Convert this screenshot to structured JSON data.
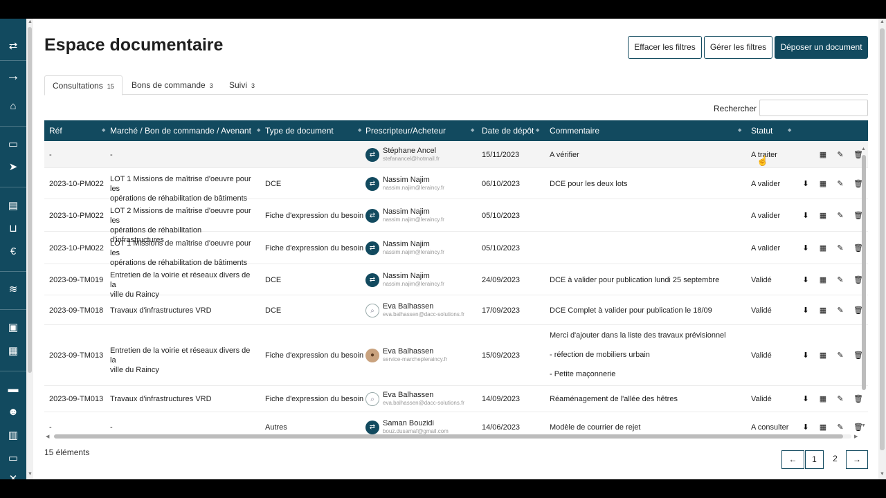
{
  "page": {
    "title": "Espace documentaire",
    "buttons": {
      "clear_filters": "Effacer les filtres",
      "manage_filters": "Gérer les filtres",
      "upload": "Déposer un document"
    }
  },
  "tabs": [
    {
      "label": "Consultations",
      "count": "15"
    },
    {
      "label": "Bons de commande",
      "count": "3"
    },
    {
      "label": "Suivi",
      "count": "3"
    }
  ],
  "search": {
    "label": "Rechercher :",
    "value": ""
  },
  "table": {
    "headers": [
      "Réf",
      "Marché / Bon de commande / Avenant",
      "Type de document",
      "Prescripteur/Acheteur",
      "Date de dépôt",
      "Commentaire",
      "Statut"
    ],
    "rows": [
      {
        "ref": "-",
        "marche": [
          "-"
        ],
        "type": "",
        "person": "Stéphane Ancel",
        "email": "stefanancel@hotmail.fr",
        "avatar": "logo",
        "date": "15/11/2023",
        "comment": [
          "A vérifier"
        ],
        "status": "A traiter",
        "actions": [
          "calendar",
          "edit",
          "delete"
        ]
      },
      {
        "ref": "2023-10-PM022",
        "marche": [
          "LOT 1 Missions de maîtrise d'oeuvre pour les",
          "opérations de réhabilitation de bâtiments"
        ],
        "type": "DCE",
        "person": "Nassim Najim",
        "email": "nassim.najim@leraincy.fr",
        "avatar": "logo",
        "date": "06/10/2023",
        "comment": [
          "DCE pour les deux lots"
        ],
        "status": "A valider",
        "actions": [
          "download",
          "calendar",
          "edit",
          "delete"
        ]
      },
      {
        "ref": "2023-10-PM022",
        "marche": [
          "LOT 2 Missions de maîtrise d'oeuvre pour les",
          "opérations de réhabilitation d'infrastructures"
        ],
        "type": "Fiche d'expression du besoin",
        "person": "Nassim Najim",
        "email": "nassim.najim@leraincy.fr",
        "avatar": "logo",
        "date": "05/10/2023",
        "comment": [
          ""
        ],
        "status": "A valider",
        "actions": [
          "download",
          "calendar",
          "edit",
          "delete"
        ]
      },
      {
        "ref": "2023-10-PM022",
        "marche": [
          "LOT 1 Missions de maîtrise d'oeuvre pour les",
          "opérations de réhabilitation de bâtiments"
        ],
        "type": "Fiche d'expression du besoin",
        "person": "Nassim Najim",
        "email": "nassim.najim@leraincy.fr",
        "avatar": "logo",
        "date": "05/10/2023",
        "comment": [
          ""
        ],
        "status": "A valider",
        "actions": [
          "download",
          "calendar",
          "edit",
          "delete"
        ]
      },
      {
        "ref": "2023-09-TM019",
        "marche": [
          "Entretien de la voirie et réseaux divers de la",
          "ville du Raincy"
        ],
        "type": "DCE",
        "person": "Nassim Najim",
        "email": "nassim.najim@leraincy.fr",
        "avatar": "logo",
        "date": "24/09/2023",
        "comment": [
          "DCE à valider pour publication lundi 25 septembre"
        ],
        "status": "Validé",
        "actions": [
          "download",
          "calendar",
          "edit",
          "delete"
        ]
      },
      {
        "ref": "2023-09-TM018",
        "marche": [
          "Travaux d'infrastructures VRD"
        ],
        "type": "DCE",
        "person": "Eva Balhassen",
        "email": "eva.balhassen@dacc-solutions.fr",
        "avatar": "outline",
        "date": "17/09/2023",
        "comment": [
          "DCE Complet à valider pour publication le 18/09"
        ],
        "status": "Validé",
        "actions": [
          "download",
          "calendar",
          "edit",
          "delete"
        ]
      },
      {
        "ref": "2023-09-TM013",
        "marche": [
          "Entretien de la voirie et réseaux divers de la",
          "ville du Raincy"
        ],
        "type": "Fiche d'expression du besoin",
        "person": "Eva Balhassen",
        "email": "service-marchepleraincy.fr",
        "avatar": "photo",
        "date": "15/09/2023",
        "comment": [
          "Merci d'ajouter dans la liste des travaux prévisionnel",
          "- réfection de mobiliers urbain",
          "- Petite maçonnerie"
        ],
        "status": "Validé",
        "actions": [
          "download",
          "calendar",
          "edit",
          "delete"
        ]
      },
      {
        "ref": "2023-09-TM013",
        "marche": [
          "Travaux d'infrastructures VRD"
        ],
        "type": "Fiche d'expression du besoin",
        "person": "Eva Balhassen",
        "email": "eva.balhassen@dacc-solutions.fr",
        "avatar": "outline",
        "date": "14/09/2023",
        "comment": [
          "Réaménagement de l'allée des hêtres"
        ],
        "status": "Validé",
        "actions": [
          "download",
          "calendar",
          "edit",
          "delete"
        ]
      },
      {
        "ref": "-",
        "marche": [
          "-"
        ],
        "type": "Autres",
        "person": "Saman Bouzidi",
        "email": "bouz.dusamaf@gmail.com",
        "avatar": "logo",
        "date": "14/06/2023",
        "comment": [
          "Modèle de courrier de rejet"
        ],
        "status": "A consulter",
        "actions": [
          "download",
          "calendar",
          "edit",
          "delete"
        ]
      }
    ]
  },
  "footer": {
    "total": "15 éléments",
    "pages": [
      "1",
      "2"
    ],
    "prev": "←",
    "next": "→"
  },
  "colors": {
    "primary": "#124a5f"
  }
}
